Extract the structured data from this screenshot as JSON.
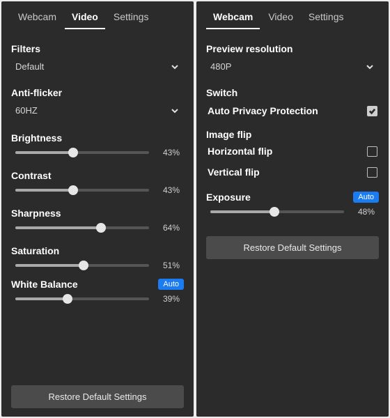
{
  "panels": {
    "left": {
      "tabs": {
        "webcam": "Webcam",
        "video": "Video",
        "settings": "Settings",
        "active": "video"
      },
      "filters": {
        "label": "Filters",
        "value": "Default"
      },
      "antiflicker": {
        "label": "Anti-flicker",
        "value": "60HZ"
      },
      "sliders": {
        "brightness": {
          "label": "Brightness",
          "pct": "43%",
          "pos": 43
        },
        "contrast": {
          "label": "Contrast",
          "pct": "43%",
          "pos": 43
        },
        "sharpness": {
          "label": "Sharpness",
          "pct": "64%",
          "pos": 64
        },
        "saturation": {
          "label": "Saturation",
          "pct": "51%",
          "pos": 51
        },
        "whitebalance": {
          "label": "White Balance",
          "pct": "39%",
          "pos": 39,
          "auto": "Auto"
        }
      },
      "restore": "Restore Default Settings"
    },
    "right": {
      "tabs": {
        "webcam": "Webcam",
        "video": "Video",
        "settings": "Settings",
        "active": "webcam"
      },
      "preview": {
        "label": "Preview resolution",
        "value": "480P"
      },
      "switch": {
        "label": "Switch"
      },
      "autoprivacy": {
        "label": "Auto Privacy Protection",
        "checked": true
      },
      "imageflip": {
        "label": "Image flip"
      },
      "hflip": {
        "label": "Horizontal flip",
        "checked": false
      },
      "vflip": {
        "label": "Vertical flip",
        "checked": false
      },
      "exposure": {
        "label": "Exposure",
        "pct": "48%",
        "pos": 48,
        "auto": "Auto"
      },
      "restore": "Restore Default Settings"
    }
  }
}
